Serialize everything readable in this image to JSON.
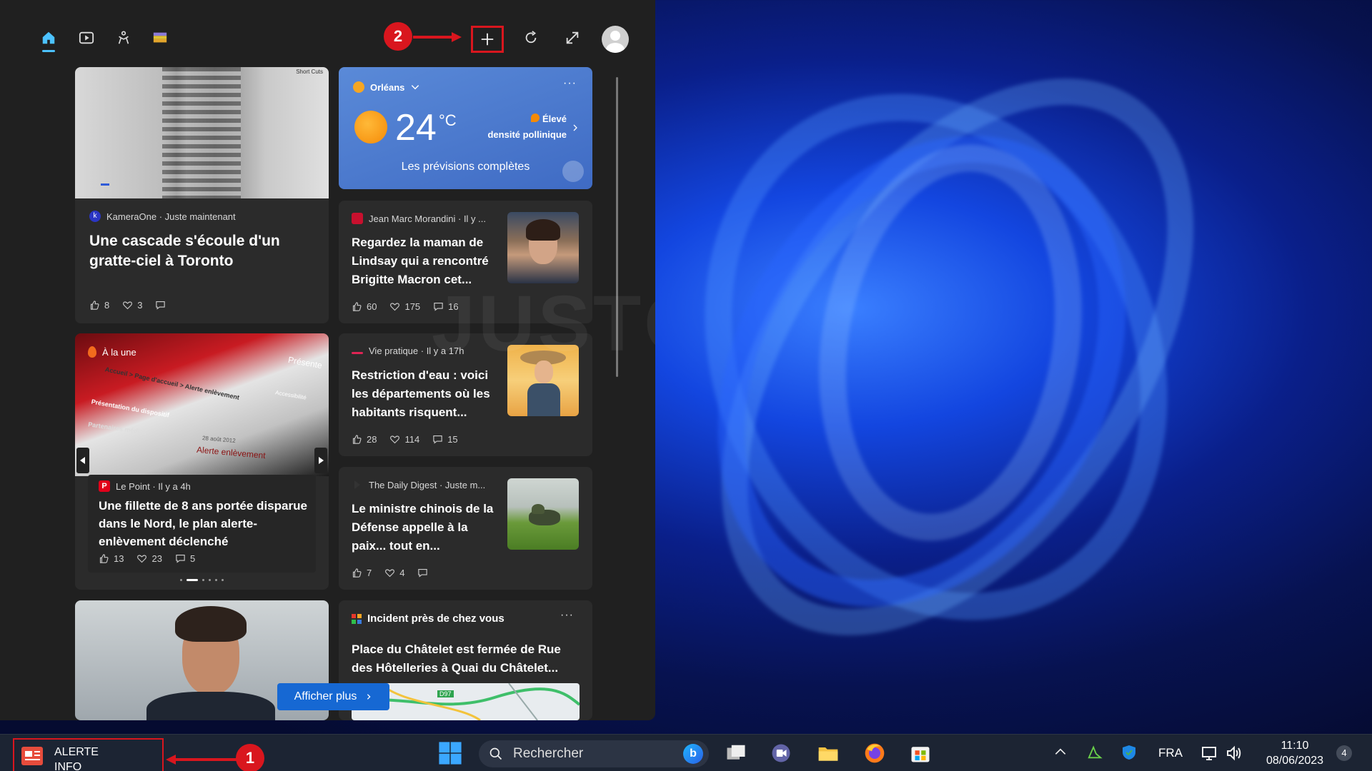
{
  "panel": {
    "tabs": [
      "home-icon",
      "play-icon",
      "heart-rate-icon",
      "color-grid-icon"
    ],
    "actions": [
      "add-icon",
      "refresh-icon",
      "expand-icon",
      "avatar"
    ]
  },
  "annotations": {
    "one": "1",
    "two": "2"
  },
  "watermark": "JUSTGEEK",
  "card_waterfall": {
    "source": "KameraOne · Juste maintenant",
    "title": "Une cascade s'écoule d'un gratte-ciel à Toronto",
    "likes": "8",
    "dislikes": "3",
    "comments": "",
    "brand": "Short Cuts"
  },
  "weather": {
    "city": "Orléans",
    "temp": "24",
    "unit": "°C",
    "pollen_level": "Élevé",
    "pollen_label": "densité pollinique",
    "link": "Les prévisions complètes"
  },
  "card_lindsay": {
    "source": "Jean Marc Morandini · Il y ...",
    "title": "Regardez la maman de Lindsay qui a rencontré Brigitte Macron cet...",
    "likes": "60",
    "dislikes": "175",
    "comments": "16"
  },
  "card_carousel": {
    "badge": "À la une",
    "source": "Le Point · Il y a 4h",
    "title": "Une fillette de 8 ans portée disparue dans le Nord, le plan alerte-enlèvement déclenché",
    "likes": "13",
    "dislikes": "23",
    "comments": "5",
    "photo_texts": [
      "Accueil > Page d'accueil > Alerte enlèvement",
      "Présentation du dispositif",
      "Partenaires médias",
      "Alerte enlèvement",
      "28 août 2012",
      "Accessibilité",
      "Présente"
    ]
  },
  "card_water": {
    "source": "Vie pratique · Il y a 17h",
    "title": "Restriction d'eau : voici les départements où les habitants risquent...",
    "likes": "28",
    "dislikes": "114",
    "comments": "15"
  },
  "card_defense": {
    "source": "The Daily Digest · Juste m...",
    "title": "Le ministre chinois de la Défense appelle à la paix... tout en...",
    "likes": "7",
    "dislikes": "4",
    "comments": ""
  },
  "card_incident": {
    "header": "Incident près de chez vous",
    "title": "Place du Châtelet est fermée de Rue des Hôtelleries à Quai du Châtelet...",
    "map_label": "D97"
  },
  "show_more": "Afficher plus",
  "taskbar": {
    "alert_line1": "ALERTE",
    "alert_line2": "INFO",
    "search_placeholder": "Rechercher",
    "lang": "FRA",
    "time": "11:10",
    "date": "08/06/2023",
    "notif_count": "4"
  },
  "colors": {
    "accent": "#4cc2ff",
    "annotation": "#d9161e",
    "weather_bg": "#4f7fd0"
  }
}
